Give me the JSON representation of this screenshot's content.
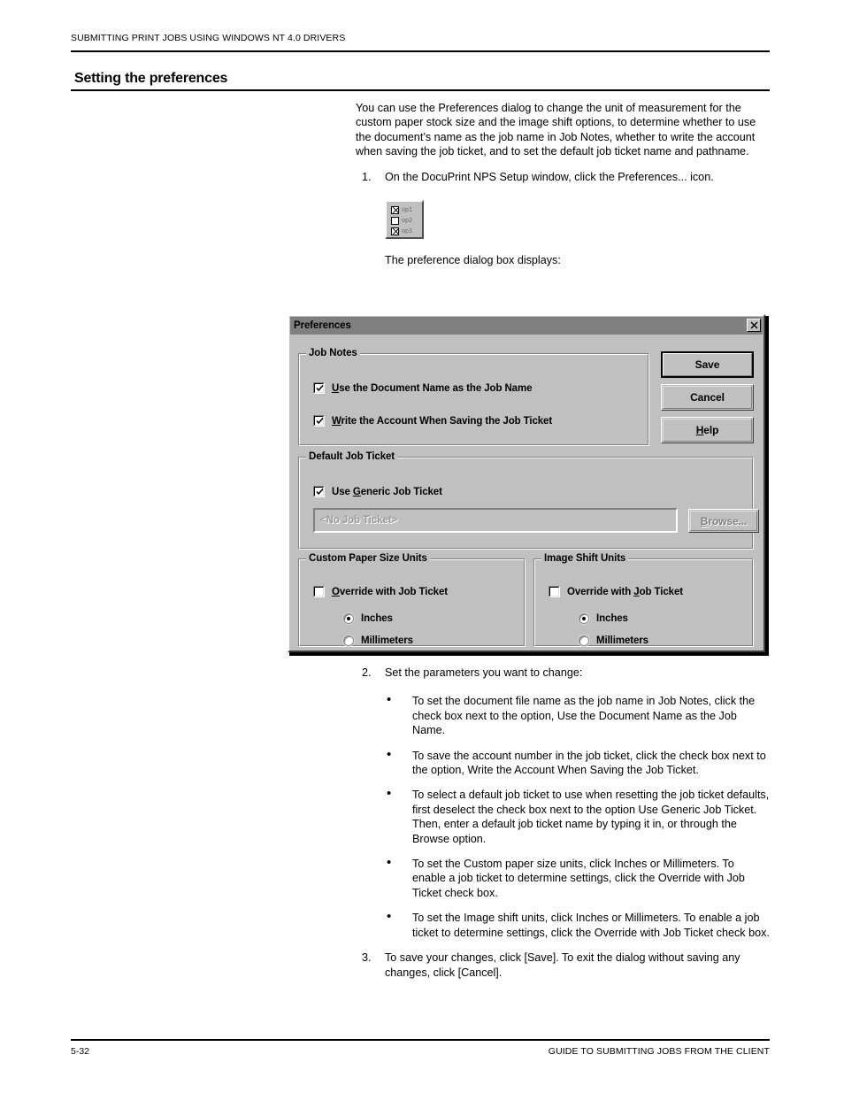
{
  "page": {
    "running_head": "SUBMITTING PRINT JOBS USING WINDOWS NT 4.0 DRIVERS",
    "section_title": "Setting the preferences",
    "footer_left": "5-32",
    "footer_right": "GUIDE TO SUBMITTING JOBS FROM THE CLIENT"
  },
  "body": {
    "intro": "You can use the Preferences dialog to change the unit of measurement for the custom paper stock size and the image shift options, to determine whether to use the document’s name as the job name in Job Notes, whether to write the account when saving the job ticket, and to set the default job ticket name and pathname.",
    "step1_num": "1.",
    "step1_text": "On the DocuPrint NPS Setup window, click the Preferences... icon.",
    "caption": "The preference dialog box displays:",
    "step2_num": "2.",
    "step2_text": "Set the parameters you want to change:",
    "bullet_char": "•",
    "bullets": [
      "To set the document file name as the job name in Job Notes, click the check box next to the option, Use the Document Name as the Job Name.",
      "To save the account number in the job ticket, click the check box next to the option, Write the Account When Saving the Job Ticket.",
      "To select a default job ticket to use when resetting the job ticket defaults, first deselect the check box next to the option Use Generic Job Ticket.  Then, enter a default job ticket name by typing it in, or through the Browse option.",
      "To set the Custom paper size units, click Inches or Millimeters. To enable a job ticket to determine settings, click the Override with Job Ticket check box.",
      "To set the Image shift units, click Inches or Millimeters. To enable a job ticket to determine settings, click the Override with Job Ticket check box."
    ],
    "step3_num": "3.",
    "step3_text": "To save your changes, click [Save]. To exit the dialog without saving any changes, click [Cancel]."
  },
  "pref_icon": {
    "rows": [
      {
        "label": "op1",
        "checked": true
      },
      {
        "label": "op2",
        "checked": false
      },
      {
        "label": "op3",
        "checked": true
      }
    ]
  },
  "dialog": {
    "title": "Preferences",
    "close_label": "✕",
    "buttons": {
      "save": "Save",
      "cancel": "Cancel",
      "help_pre": "",
      "help_accel": "H",
      "help_post": "elp"
    },
    "job_notes": {
      "legend": "Job Notes",
      "checkbox1": {
        "pre": "",
        "accel": "U",
        "post": "se the Document Name as the Job Name",
        "checked": true
      },
      "checkbox2": {
        "pre": "",
        "accel": "W",
        "post": "rite the Account When Saving the Job Ticket",
        "checked": true
      }
    },
    "default_job_ticket": {
      "legend": "Default Job Ticket",
      "checkbox": {
        "pre": "Use ",
        "accel": "G",
        "post": "eneric Job Ticket",
        "checked": true
      },
      "field_value": "<No Job Ticket>",
      "browse_pre": "",
      "browse_accel": "B",
      "browse_post": "rowse...",
      "browse_disabled": true
    },
    "custom_paper": {
      "legend": "Custom Paper Size Units",
      "checkbox": {
        "pre": "",
        "accel": "O",
        "post": "verride with Job Ticket",
        "checked": false
      },
      "radios": [
        {
          "label": "Inches",
          "selected": true
        },
        {
          "label": "Millimeters",
          "selected": false
        }
      ]
    },
    "image_shift": {
      "legend": "Image Shift Units",
      "checkbox": {
        "pre": "Override with ",
        "accel": "J",
        "post": "ob Ticket",
        "checked": false
      },
      "radios": [
        {
          "label": "Inches",
          "selected": true
        },
        {
          "label": "Millimeters",
          "selected": false
        }
      ]
    }
  },
  "colors": {
    "dialog_face": "#c0c0c0",
    "titlebar": "#808080",
    "text": "#000000",
    "disabled_text": "#808080"
  }
}
